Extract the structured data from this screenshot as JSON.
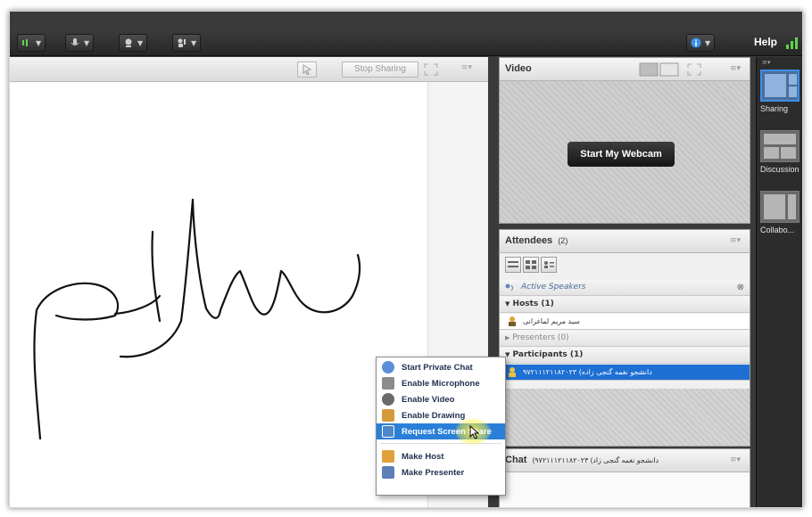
{
  "toolbar": {
    "buttons": [
      {
        "name": "audio-status-button",
        "icon": "audio-meter-icon"
      },
      {
        "name": "microphone-button",
        "icon": "microphone-icon"
      },
      {
        "name": "webcam-button",
        "icon": "webcam-icon"
      },
      {
        "name": "raise-hand-button",
        "icon": "hand-icon"
      },
      {
        "name": "info-button",
        "icon": "info-icon"
      }
    ],
    "help_label": "Help"
  },
  "share_pod": {
    "stop_sharing_label": "Stop Sharing",
    "drawing": "سلام"
  },
  "video_pod": {
    "title": "Video",
    "start_webcam_label": "Start My Webcam"
  },
  "attendees_pod": {
    "title": "Attendees",
    "count": "(2)",
    "active_speakers_label": "Active Speakers",
    "hosts_label": "Hosts (1)",
    "host_name": "سید مریم لماغرانی",
    "presenters_label": "Presenters (0)",
    "participants_label": "Participants (1)",
    "participant_name": "۹۷۲۱۱۱۲۱۱۸۲۰۲۳ (دانشجو نغمه گنجی زاده"
  },
  "chat_pod": {
    "title": "Chat",
    "recipient": "(۹۷۲۱۱۱۲۱۱۸۲۰۲۳ (دانشجو نغمه گنجی زاد"
  },
  "layouts": [
    {
      "label": "Sharing",
      "active": true
    },
    {
      "label": "Discussion",
      "active": false
    },
    {
      "label": "Collabo...",
      "active": false
    }
  ],
  "context_menu": {
    "items": [
      {
        "label": "Start Private Chat",
        "icon": "chat-bubble-icon",
        "color": "#5b8fd6"
      },
      {
        "label": "Enable Microphone",
        "icon": "microphone-icon",
        "color": "#8c8c8c"
      },
      {
        "label": "Enable Video",
        "icon": "webcam-icon",
        "color": "#6a6a6a"
      },
      {
        "label": "Enable Drawing",
        "icon": "pencil-icon",
        "color": "#d79a3a"
      },
      {
        "label": "Request Screen Share",
        "icon": "screen-share-icon",
        "color": "#4f86c9",
        "highlighted": true
      }
    ],
    "items2": [
      {
        "label": "Make Host",
        "icon": "host-icon",
        "color": "#e0a13a"
      },
      {
        "label": "Make Presenter",
        "icon": "presenter-icon",
        "color": "#5c7fb5"
      }
    ]
  },
  "colors": {
    "selection_blue": "#1d6fd4",
    "menu_highlight": "#2a7fd8",
    "toolbar_dark": "#2a2a2a"
  }
}
